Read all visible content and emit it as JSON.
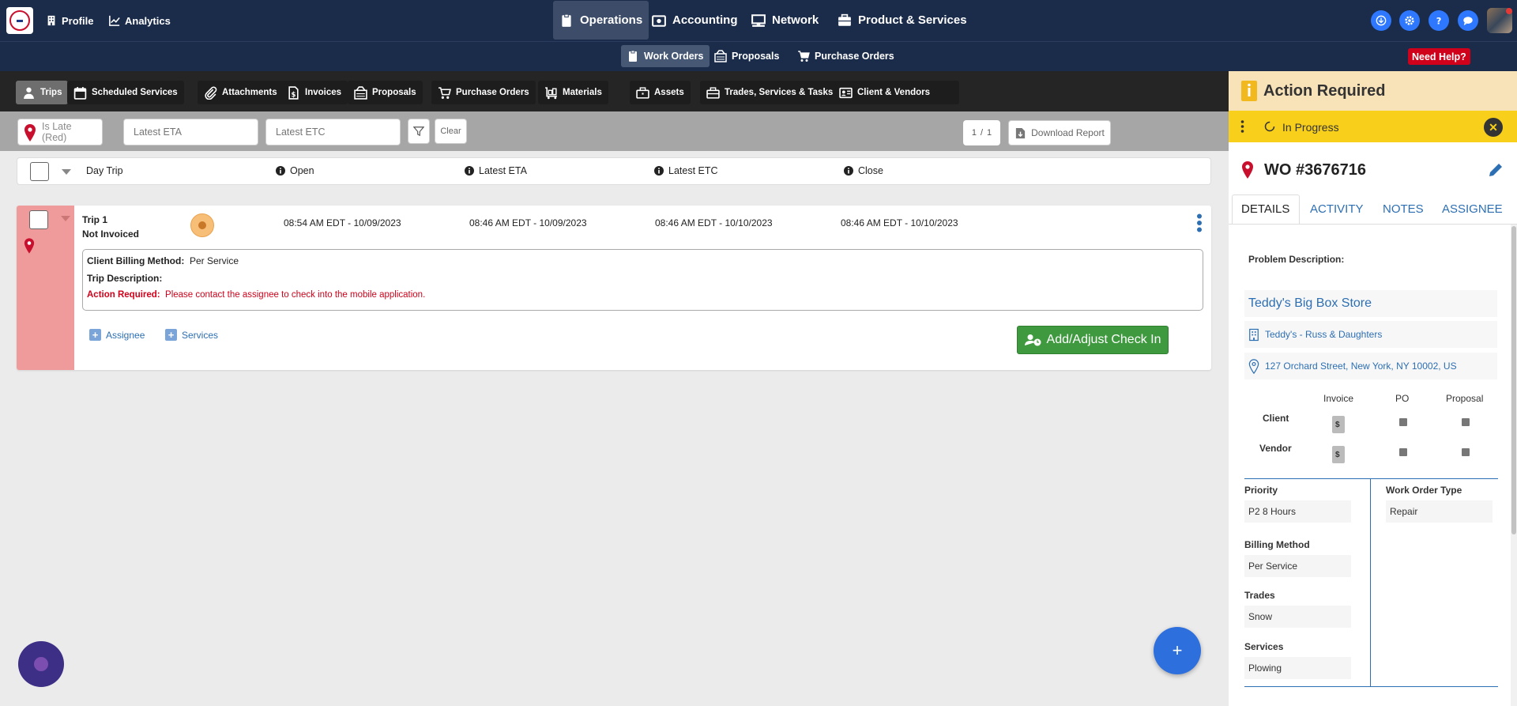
{
  "topnav": {
    "left": [
      {
        "label": "Profile",
        "icon": "building-icon"
      },
      {
        "label": "Analytics",
        "icon": "chart-line-icon"
      }
    ],
    "main": [
      {
        "label": "Operations",
        "icon": "clipboard-icon",
        "active": true
      },
      {
        "label": "Accounting",
        "icon": "cash-icon",
        "active": false
      },
      {
        "label": "Network",
        "icon": "network-icon",
        "active": false
      },
      {
        "label": "Product & Services",
        "icon": "briefcase-icon",
        "active": false
      }
    ],
    "right_icons": [
      "download-icon",
      "gear-icon",
      "help-icon",
      "chat-icon"
    ]
  },
  "subnav": {
    "items": [
      {
        "label": "Work Orders",
        "icon": "clipboard-icon",
        "active": true
      },
      {
        "label": "Proposals",
        "icon": "proposal-icon",
        "active": false
      },
      {
        "label": "Purchase Orders",
        "icon": "cart-icon",
        "active": false
      }
    ],
    "help_label": "Need Help?"
  },
  "tabs": [
    {
      "label": "Trips",
      "icon": "person-icon",
      "active": true
    },
    {
      "label": "Scheduled Services",
      "icon": "calendar-icon",
      "active": false
    },
    {
      "label": "Attachments",
      "icon": "paperclip-icon",
      "active": false
    },
    {
      "label": "Invoices",
      "icon": "invoice-icon",
      "active": false
    },
    {
      "label": "Proposals",
      "icon": "proposal-icon",
      "active": false
    },
    {
      "label": "Purchase Orders",
      "icon": "cart-icon",
      "active": false
    },
    {
      "label": "Materials",
      "icon": "cart-flat-icon",
      "active": false
    },
    {
      "label": "Assets",
      "icon": "assets-icon",
      "active": false
    },
    {
      "label": "Trades, Services & Tasks",
      "icon": "toolbox-icon",
      "active": false
    },
    {
      "label": "Client & Vendors",
      "icon": "id-card-icon",
      "active": false
    }
  ],
  "filters": {
    "late_label": "Is Late (Red)",
    "eta_placeholder": "Latest ETA",
    "etc_placeholder": "Latest ETC",
    "clear_label": "Clear",
    "pager_current": "1",
    "pager_sep": "/",
    "pager_total": "1",
    "download_label": "Download Report"
  },
  "table_header": {
    "col_daytrip": "Day Trip",
    "col_open": "Open",
    "col_eta": "Latest ETA",
    "col_etc": "Latest ETC",
    "col_close": "Close"
  },
  "trip": {
    "name": "Trip 1",
    "status": "Not Invoiced",
    "open": "08:54 AM EDT - 10/09/2023",
    "eta": "08:46 AM EDT - 10/09/2023",
    "etc": "08:46 AM EDT - 10/10/2023",
    "close": "08:46 AM EDT - 10/10/2023",
    "billing_label": "Client Billing Method:",
    "billing_value": "Per Service",
    "desc_label": "Trip Description:",
    "action_label": "Action Required:",
    "action_text": "Please contact the assignee to check into the mobile application.",
    "assignee_label": "Assignee",
    "services_label": "Services",
    "checkin_label": "Add/Adjust Check In"
  },
  "fab_label": "+",
  "panel": {
    "header": "Action Required",
    "status": "In Progress",
    "close_label": "✕",
    "wo_title": "WO #3676716",
    "tabs": [
      "DETAILS",
      "ACTIVITY",
      "NOTES",
      "ASSIGNEE"
    ],
    "problem_label": "Problem Description:",
    "store_name": "Teddy's Big Box Store",
    "store_location": "Teddy's - Russ & Daughters",
    "address": "127 Orchard Street, New York, NY 10002, US",
    "doc_cols": [
      "Invoice",
      "PO",
      "Proposal"
    ],
    "doc_rows": [
      "Client",
      "Vendor"
    ],
    "priority_label": "Priority",
    "priority_value": "P2 8 Hours",
    "billing_label": "Billing Method",
    "billing_value": "Per Service",
    "trades_label": "Trades",
    "trades_value": "Snow",
    "services_label": "Services",
    "services_value": "Plowing",
    "wo_type_label": "Work Order Type",
    "wo_type_value": "Repair"
  },
  "colors": {
    "nav_bg": "#1b2c4b",
    "late_red": "#f09b9b",
    "action_red": "#d0021b",
    "checkin_green": "#3f9a3f",
    "panel_yellow": "#f8cf1a",
    "panel_header": "#f8e2b8",
    "link_blue": "#2d6fb3"
  }
}
